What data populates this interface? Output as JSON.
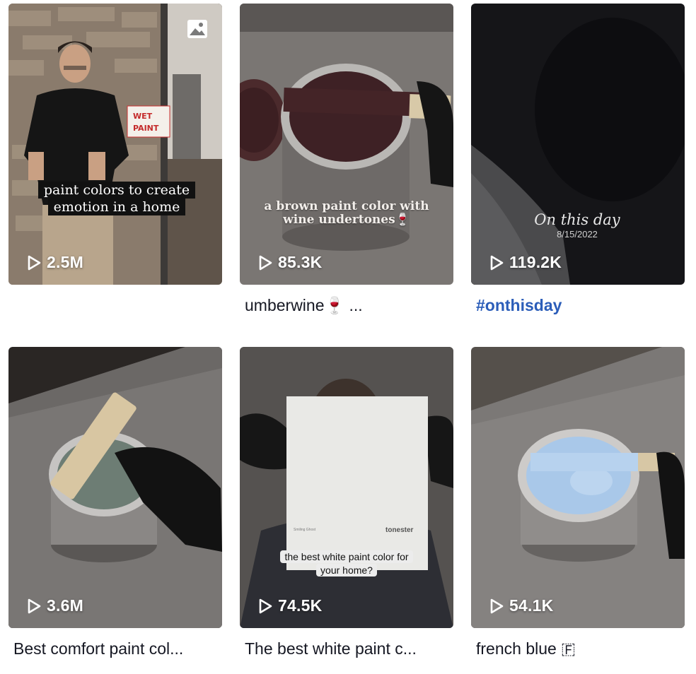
{
  "videos": [
    {
      "views": "2.5M",
      "caption": "",
      "overlay_line1": "paint colors to create",
      "overlay_line2": "emotion in a home",
      "sign_line1": "WET",
      "sign_line2": "PAINT",
      "is_photo_post": true,
      "icon": "photo-icon"
    },
    {
      "views": "85.3K",
      "caption": "umberwine🍷 ...",
      "overlay_line1": "a brown paint color with",
      "overlay_line2": "wine undertones🍷"
    },
    {
      "views": "119.2K",
      "caption": "#onthisday",
      "overlay_line1": "On this day",
      "overlay_line2": "8/15/2022"
    },
    {
      "views": "3.6M",
      "caption": "Best comfort paint col..."
    },
    {
      "views": "74.5K",
      "caption": "The best white paint c...",
      "overlay_line1": "the best white paint color for",
      "overlay_line2": "your home?",
      "card_brand": "tonester",
      "card_small": "Smiling Ghost"
    },
    {
      "views": "54.1K",
      "caption": "french blue 🇫"
    }
  ],
  "colors": {
    "caption_text": "#161823",
    "hashtag": "#2b5db9",
    "views_text": "#ffffff"
  }
}
